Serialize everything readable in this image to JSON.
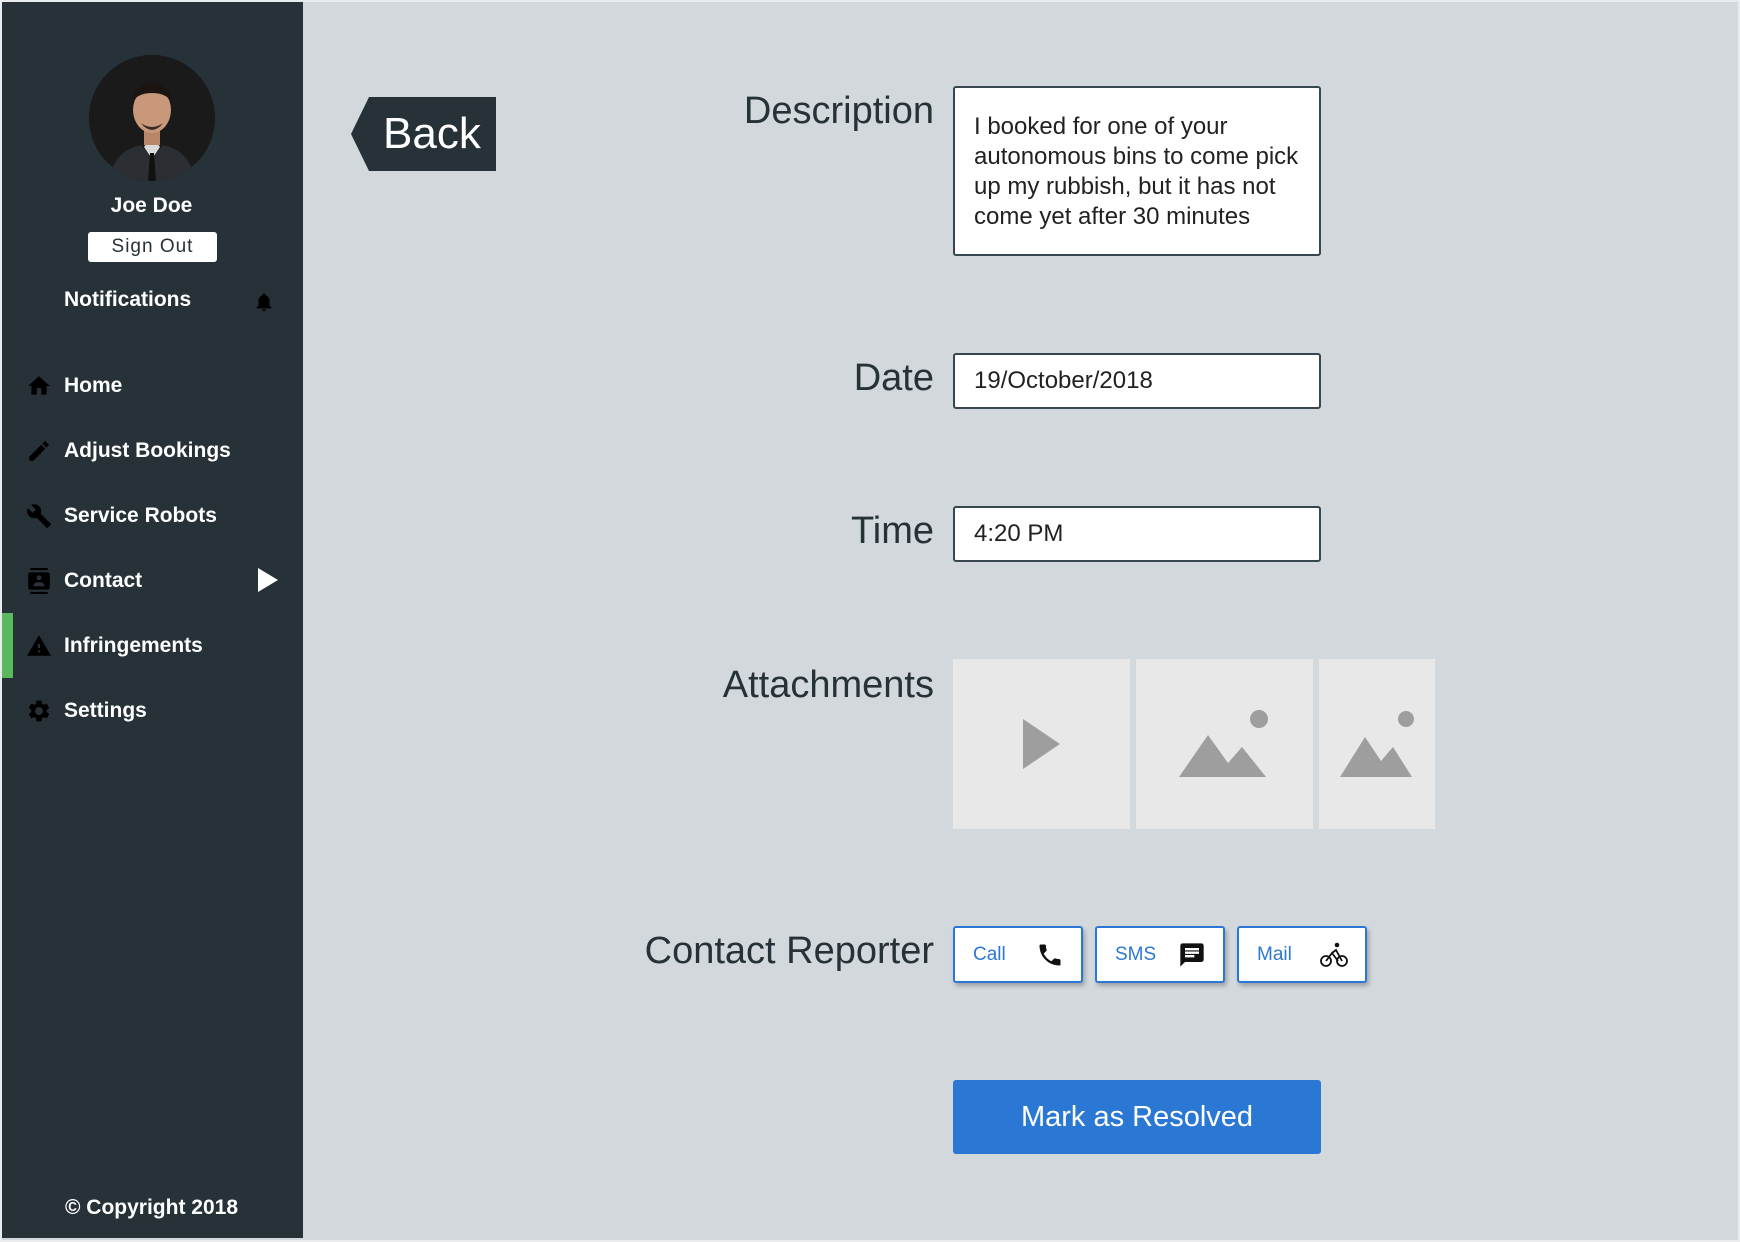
{
  "sidebar": {
    "user_name": "Joe Doe",
    "sign_out": "Sign Out",
    "notifications": "Notifications",
    "nav": [
      {
        "label": "Home",
        "icon": "home-icon"
      },
      {
        "label": "Adjust Bookings",
        "icon": "pencil-icon"
      },
      {
        "label": "Service Robots",
        "icon": "wrench-icon"
      },
      {
        "label": "Contact",
        "icon": "contacts-icon"
      },
      {
        "label": "Infringements",
        "icon": "warning-icon",
        "active": true
      },
      {
        "label": "Settings",
        "icon": "gear-icon"
      }
    ],
    "copyright": "© Copyright 2018",
    "active_accent": "#5cb85c",
    "background": "#263238"
  },
  "main": {
    "back_label": "Back",
    "description_label": "Description",
    "description_value": "I booked for one of your autonomous bins to come pick up my rubbish, but it has not come yet after 30 minutes",
    "date_label": "Date",
    "date_value": "19/October/2018",
    "time_label": "Time",
    "time_value": "4:20 PM",
    "attachments_label": "Attachments",
    "attachments": [
      "video",
      "image",
      "image"
    ],
    "contact_label": "Contact Reporter",
    "contact_buttons": [
      {
        "label": "Call",
        "icon": "phone-icon"
      },
      {
        "label": "SMS",
        "icon": "message-icon"
      },
      {
        "label": "Mail",
        "icon": "bicycle-icon"
      }
    ],
    "resolve_label": "Mark as Resolved",
    "accent": "#2b78d4"
  }
}
